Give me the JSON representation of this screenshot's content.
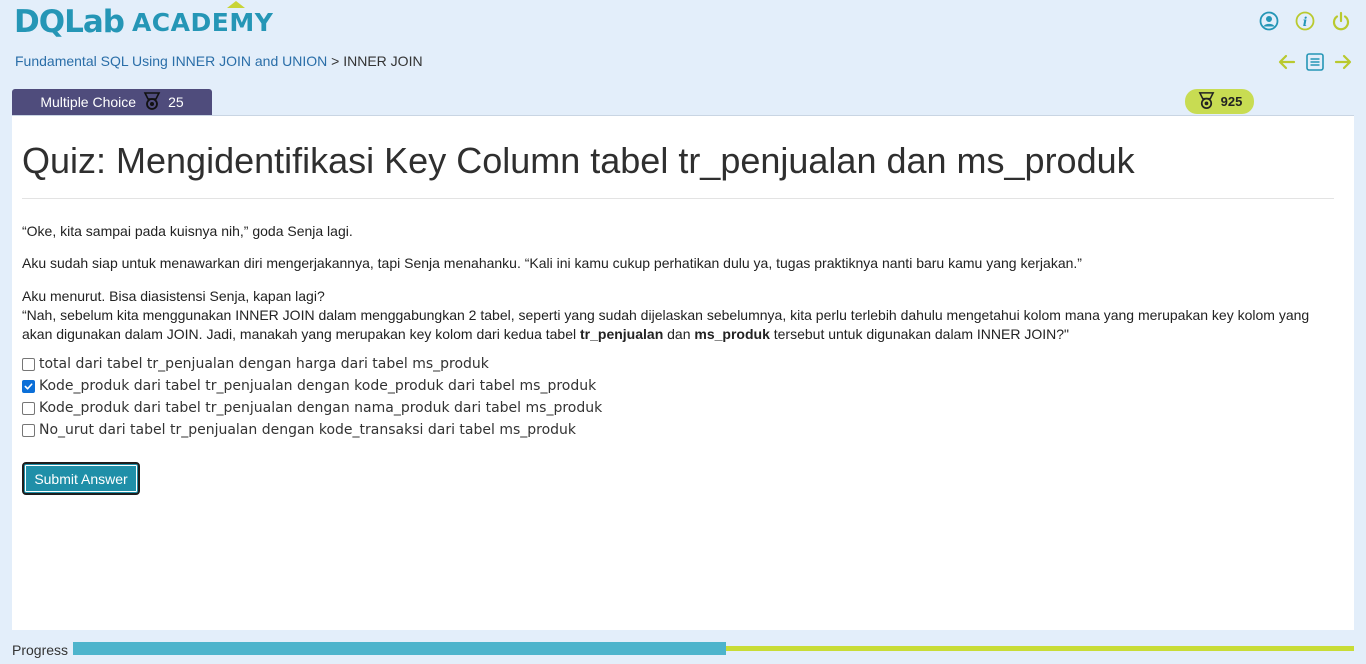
{
  "logo": {
    "main": "DQLab",
    "sub": "ACADEMY"
  },
  "header_icons": [
    "user-icon",
    "info-icon",
    "power-icon"
  ],
  "breadcrumb": {
    "course": "Fundamental SQL Using INNER JOIN and UNION",
    "separator": ">",
    "current": "INNER JOIN"
  },
  "nav_icons": [
    "arrow-left-icon",
    "list-icon",
    "arrow-right-icon"
  ],
  "tab": {
    "label": "Multiple Choice",
    "points": "25"
  },
  "score": "925",
  "quiz": {
    "title": "Quiz: Mengidentifikasi Key Column tabel tr_penjualan dan ms_produk",
    "p1": "“Oke, kita sampai pada kuisnya nih,” goda Senja lagi.",
    "p2": "Aku sudah siap untuk menawarkan diri mengerjakannya, tapi Senja menahanku. “Kali ini kamu cukup perhatikan dulu ya, tugas praktiknya nanti baru kamu yang kerjakan.”",
    "p3_line1": "Aku menurut. Bisa diasistensi Senja, kapan lagi?",
    "p3_line2_a": "“Nah, sebelum kita menggunakan INNER JOIN dalam menggabungkan 2 tabel, seperti yang sudah dijelaskan sebelumnya, kita perlu terlebih dahulu mengetahui kolom mana yang merupakan key kolom yang akan digunakan dalam JOIN. Jadi, manakah yang merupakan key kolom dari kedua tabel ",
    "p3_bold1": "tr_penjualan",
    "p3_mid": " dan ",
    "p3_bold2": "ms_produk",
    "p3_end": " tersebut untuk digunakan dalam INNER JOIN?\"",
    "options": [
      {
        "label": "total dari tabel tr_penjualan dengan harga dari tabel ms_produk",
        "checked": false
      },
      {
        "label": "Kode_produk dari tabel tr_penjualan dengan kode_produk dari tabel ms_produk",
        "checked": true
      },
      {
        "label": "Kode_produk dari tabel tr_penjualan dengan nama_produk dari tabel ms_produk",
        "checked": false
      },
      {
        "label": "No_urut dari tabel tr_penjualan dengan kode_transaksi dari tabel ms_produk",
        "checked": false
      }
    ],
    "submit_label": "Submit Answer"
  },
  "progress": {
    "label": "Progress",
    "fraction": 0.51
  },
  "colors": {
    "accent": "#2596b6",
    "tab": "#4f4c7c",
    "lime": "#c8dc52",
    "submit": "#1f8fa8",
    "progress_fill": "#4db4cc"
  }
}
